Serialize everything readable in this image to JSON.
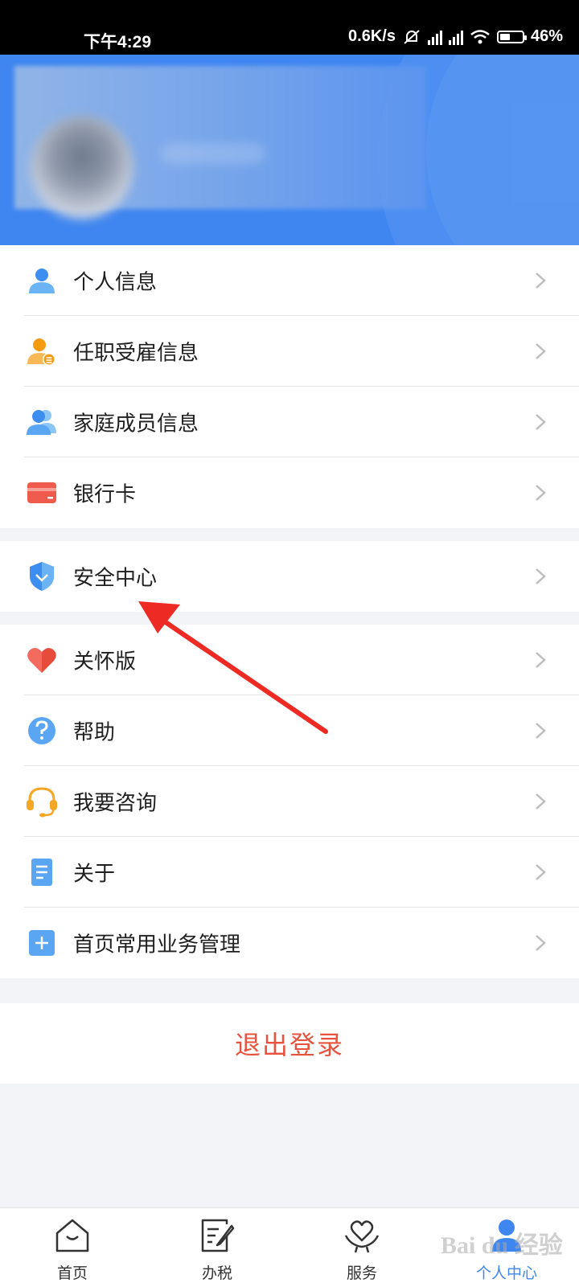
{
  "status_bar": {
    "time": "下午4:29",
    "network_speed": "0.6K/s",
    "battery": "46%",
    "battery_level": 0.46
  },
  "profile_header": {
    "accent_color": "#3f86f0"
  },
  "menu_group_1": {
    "items": [
      {
        "label": "个人信息",
        "icon": "person-icon",
        "color": "#4a90e2"
      },
      {
        "label": "任职受雇信息",
        "icon": "employment-icon",
        "color": "#f5a623"
      },
      {
        "label": "家庭成员信息",
        "icon": "family-icon",
        "color": "#4a90e2"
      },
      {
        "label": "银行卡",
        "icon": "bank-card-icon",
        "color": "#ef5b4c"
      }
    ]
  },
  "menu_group_2": {
    "items": [
      {
        "label": "安全中心",
        "icon": "shield-icon",
        "color": "#4a90e2"
      }
    ]
  },
  "menu_group_3": {
    "items": [
      {
        "label": "关怀版",
        "icon": "heart-icon",
        "color": "#ef5b4c"
      },
      {
        "label": "帮助",
        "icon": "question-icon",
        "color": "#4a90e2"
      },
      {
        "label": "我要咨询",
        "icon": "headset-icon",
        "color": "#f5a623"
      },
      {
        "label": "关于",
        "icon": "document-icon",
        "color": "#4a90e2"
      },
      {
        "label": "首页常用业务管理",
        "icon": "plus-square-icon",
        "color": "#4a90e2"
      }
    ]
  },
  "logout": {
    "label": "退出登录",
    "color": "#e8523e"
  },
  "tab_bar": {
    "tabs": [
      {
        "label": "首页",
        "icon": "home-icon",
        "active": false
      },
      {
        "label": "办税",
        "icon": "edit-doc-icon",
        "active": false
      },
      {
        "label": "服务",
        "icon": "service-heart-icon",
        "active": false
      },
      {
        "label": "个人中心",
        "icon": "profile-icon",
        "active": true
      }
    ]
  },
  "watermark": {
    "text": "Bai du 经验"
  }
}
